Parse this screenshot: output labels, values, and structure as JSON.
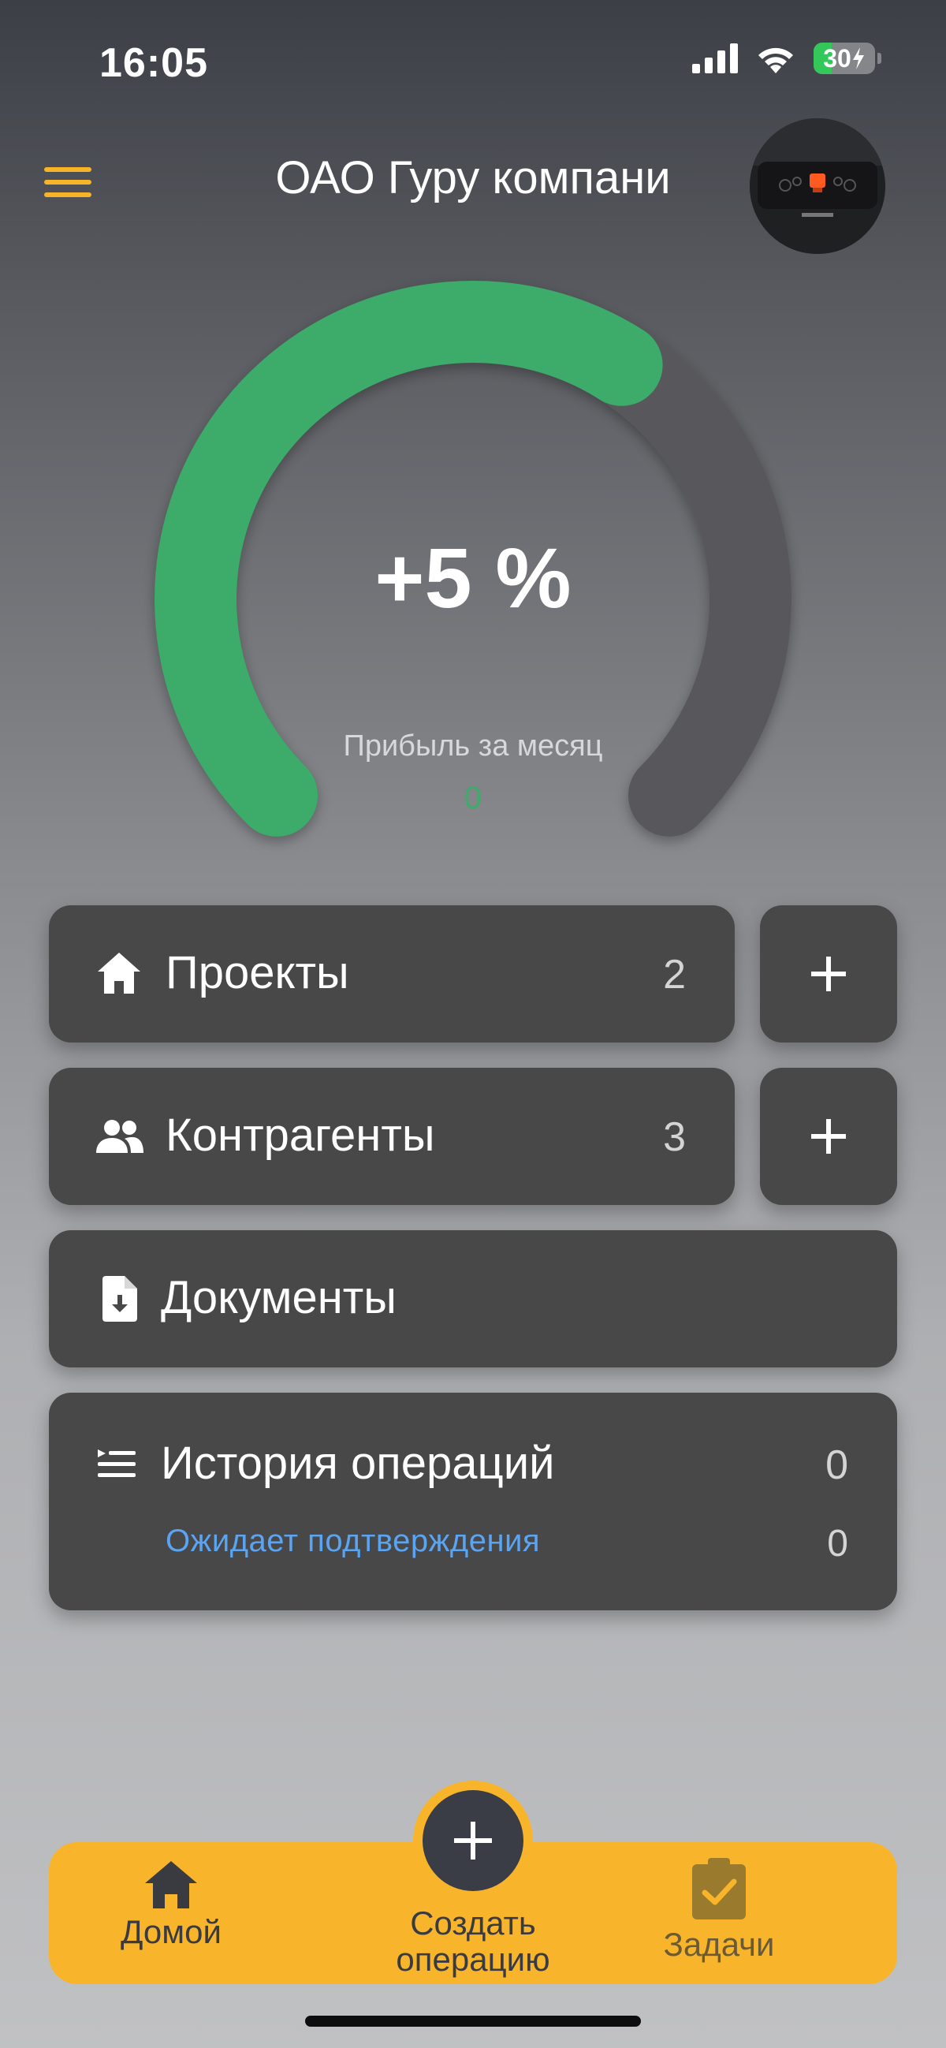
{
  "status_bar": {
    "time": "16:05",
    "battery_percent": "30"
  },
  "header": {
    "title": "ОАО Гуру компани"
  },
  "gauge": {
    "value_text": "+5 %",
    "label": "Прибыль за месяц",
    "sub_value": "0",
    "fill_fraction": 0.62
  },
  "menu": {
    "projects": {
      "label": "Проекты",
      "count": "2"
    },
    "counterparties": {
      "label": "Контрагенты",
      "count": "3"
    },
    "documents": {
      "label": "Документы"
    },
    "history": {
      "label": "История операций",
      "count": "0",
      "pending_label": "Ожидает подтверждения",
      "pending_count": "0"
    }
  },
  "bottom_nav": {
    "home_label": "Домой",
    "create_label_line1": "Создать",
    "create_label_line2": "операцию",
    "tasks_label": "Задачи"
  },
  "colors": {
    "accent": "#f8b52b",
    "gauge_fill": "#3dab6a",
    "card": "#484848",
    "link": "#5aa4f2"
  }
}
